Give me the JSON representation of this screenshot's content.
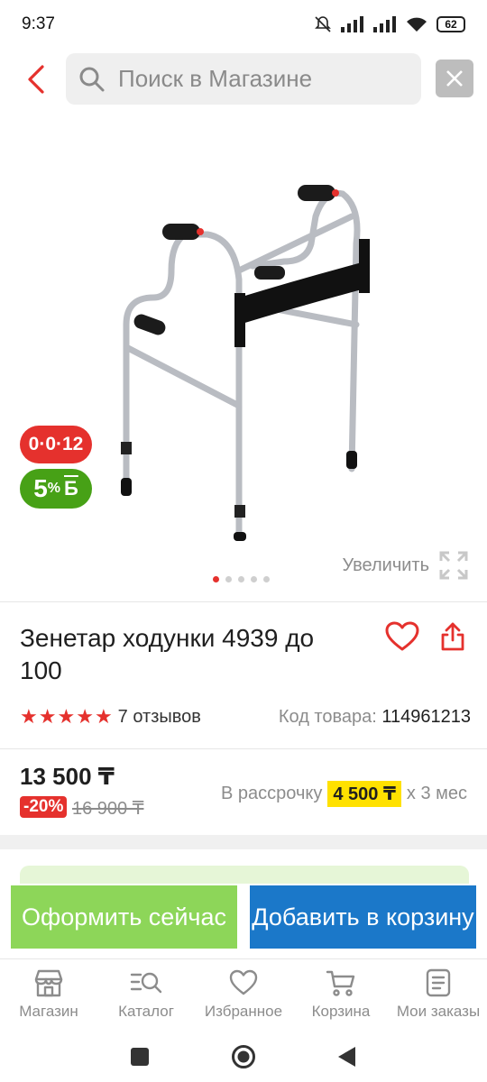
{
  "status_bar": {
    "time": "9:37",
    "battery": "62"
  },
  "search": {
    "placeholder": "Поиск в Магазине"
  },
  "gallery": {
    "badge_installment": "0·0·12",
    "badge_bonus_value": "5",
    "badge_bonus_pct": "%",
    "badge_bonus_letter": "Б",
    "zoom_label": "Увеличить",
    "slides_total": 5,
    "slide_active": 1
  },
  "product": {
    "title": "Зенетар ходунки 4939 до 100",
    "rating": 4.5,
    "reviews": "7 отзывов",
    "sku_label": "Код товара:",
    "sku_value": "114961213"
  },
  "pricing": {
    "price": "13 500 ₸",
    "discount": "-20%",
    "old_price": "16 900 ₸",
    "installment_label": "В рассрочку",
    "installment_amount": "4 500 ₸",
    "installment_term": "x 3 мес"
  },
  "actions": {
    "buy_now": "Оформить сейчас",
    "add_to_cart": "Добавить в корзину"
  },
  "tabs": [
    {
      "label": "Магазин",
      "icon": "store-icon"
    },
    {
      "label": "Каталог",
      "icon": "catalog-icon"
    },
    {
      "label": "Избранное",
      "icon": "heart-icon"
    },
    {
      "label": "Корзина",
      "icon": "cart-icon"
    },
    {
      "label": "Мои заказы",
      "icon": "orders-icon"
    }
  ],
  "colors": {
    "accent_red": "#e5312d",
    "bonus_green": "#47a116",
    "buy_green": "#8dd659",
    "cart_blue": "#1b78c9",
    "installment_yellow": "#ffe100"
  }
}
